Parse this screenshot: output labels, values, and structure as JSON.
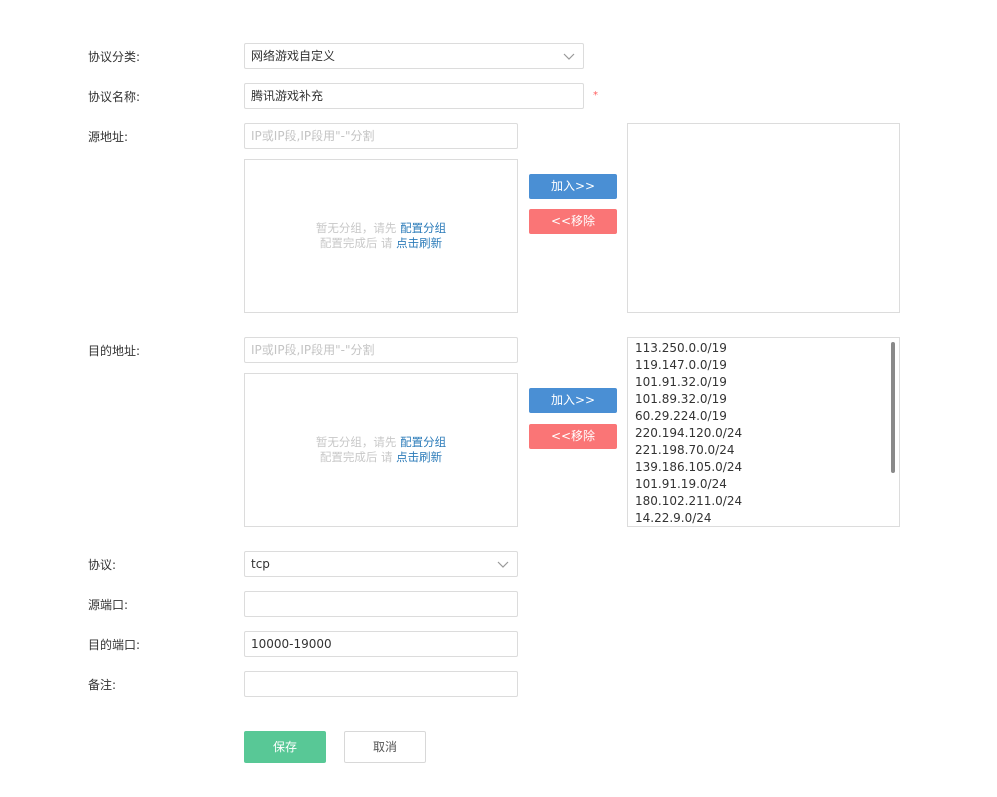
{
  "form": {
    "category": {
      "label": "协议分类:",
      "value": "网络游戏自定义"
    },
    "name": {
      "label": "协议名称:",
      "value": "腾讯游戏补充",
      "required_mark": "*"
    },
    "source": {
      "label": "源地址:",
      "placeholder": "IP或IP段,IP段用\"-\"分割",
      "empty_line1": "暂无分组，请先",
      "empty_link1": "配置分组",
      "empty_line2": "配置完成后 请",
      "empty_link2": "点击刷新",
      "add_label": "加入>>",
      "remove_label": "<<移除",
      "selected": []
    },
    "destination": {
      "label": "目的地址:",
      "placeholder": "IP或IP段,IP段用\"-\"分割",
      "empty_line1": "暂无分组，请先",
      "empty_link1": "配置分组",
      "empty_line2": "配置完成后 请",
      "empty_link2": "点击刷新",
      "add_label": "加入>>",
      "remove_label": "<<移除",
      "selected": [
        "113.250.0.0/19",
        "119.147.0.0/19",
        "101.91.32.0/19",
        "101.89.32.0/19",
        "60.29.224.0/19",
        "220.194.120.0/24",
        "221.198.70.0/24",
        "139.186.105.0/24",
        "101.91.19.0/24",
        "180.102.211.0/24",
        "14.22.9.0/24"
      ]
    },
    "protocol": {
      "label": "协议:",
      "value": "tcp"
    },
    "src_port": {
      "label": "源端口:",
      "value": ""
    },
    "dst_port": {
      "label": "目的端口:",
      "value": "10000-19000"
    },
    "remark": {
      "label": "备注:",
      "value": ""
    }
  },
  "actions": {
    "save_label": "保存",
    "cancel_label": "取消"
  },
  "icons": {
    "select_arrow": "chevron-down-icon"
  },
  "colors": {
    "add_button": "#4a8fd4",
    "remove_button": "#fa7576",
    "save_button": "#58c896",
    "link": "#2b7bb9",
    "required": "#ff5e5e"
  }
}
